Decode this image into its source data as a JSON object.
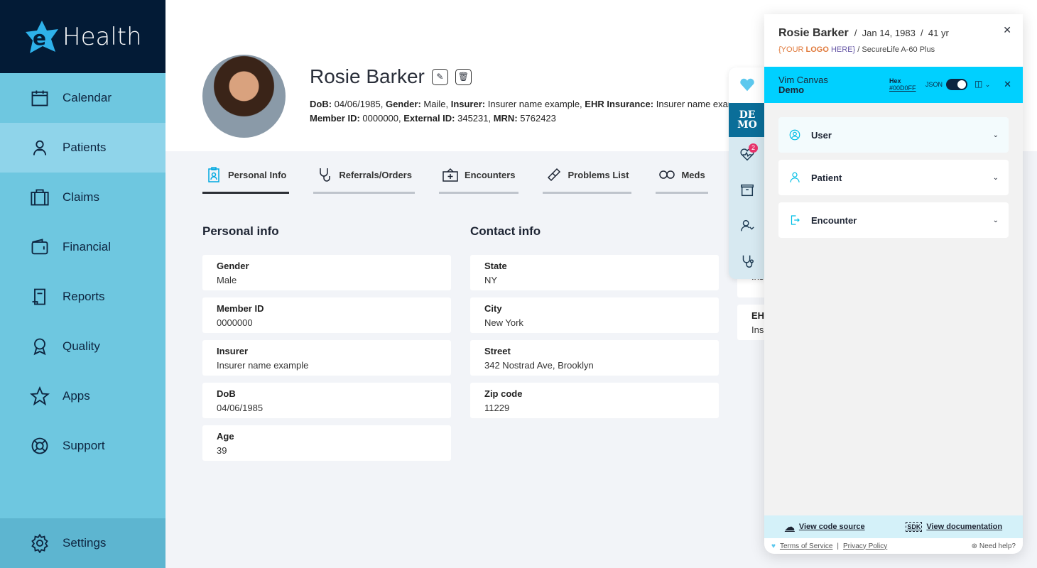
{
  "app": {
    "logo_text": "Health",
    "logo_letter": "e"
  },
  "sidebar": {
    "items": [
      {
        "label": "Calendar",
        "icon": "calendar-icon"
      },
      {
        "label": "Patients",
        "icon": "patient-icon",
        "active": true
      },
      {
        "label": "Claims",
        "icon": "briefcase-icon"
      },
      {
        "label": "Financial",
        "icon": "wallet-icon"
      },
      {
        "label": "Reports",
        "icon": "report-icon"
      },
      {
        "label": "Quality",
        "icon": "award-icon"
      },
      {
        "label": "Apps",
        "icon": "star-icon"
      },
      {
        "label": "Support",
        "icon": "lifebuoy-icon"
      }
    ],
    "settings": "Settings"
  },
  "patient": {
    "name": "Rosie Barker",
    "meta_line1": [
      [
        "DoB:",
        " 04/06/1985, "
      ],
      [
        "Gender:",
        " Maile, "
      ],
      [
        "Insurer:",
        " Insurer name example, "
      ],
      [
        "EHR Insurance:",
        " Insurer name example"
      ]
    ],
    "meta_line2": [
      [
        "Member ID:",
        " 0000000, "
      ],
      [
        "External ID:",
        " 345231, "
      ],
      [
        "MRN:",
        " 5762423"
      ]
    ]
  },
  "tabs": [
    "Personal Info",
    "Referrals/Orders",
    "Encounters",
    "Problems List",
    "Meds"
  ],
  "personal": {
    "title": "Personal info",
    "fields": [
      [
        "Gender",
        "Male"
      ],
      [
        "Member ID",
        "0000000"
      ],
      [
        "Insurer",
        "Insurer name example"
      ],
      [
        "DoB",
        "04/06/1985"
      ],
      [
        "Age",
        "39"
      ]
    ]
  },
  "contact": {
    "title": "Contact info",
    "fields": [
      [
        "State",
        "NY"
      ],
      [
        "City",
        "New York"
      ],
      [
        "Street",
        "342 Nostrad Ave, Brooklyn"
      ],
      [
        "Zip code",
        "11229"
      ]
    ]
  },
  "partial": {
    "fields": [
      [
        "",
        "Ins"
      ],
      [
        "EH",
        "Ins"
      ]
    ]
  },
  "strip": {
    "demo": "DE MO",
    "badge": "2"
  },
  "panel": {
    "name": "Rosie Barker",
    "dob": "Jan 14, 1983",
    "age": "41 yr",
    "logo_open": "{YOUR ",
    "logo_bold": "LOGO",
    "logo_close": " HERE}",
    "plan": "/ SecureLife A-60 Plus",
    "app_name": "Vim Canvas",
    "app_sub": "Demo",
    "hex_label": "Hex",
    "hex_value": "#00D0FF",
    "json_label": "JSON",
    "json_on": true,
    "accent": "#00D0FF",
    "sections": [
      "User",
      "Patient",
      "Encounter"
    ],
    "view_code": "View code source",
    "view_docs": "View documentation",
    "terms": "Terms of Service",
    "privacy": "Privacy Policy",
    "help": "Need help?"
  }
}
